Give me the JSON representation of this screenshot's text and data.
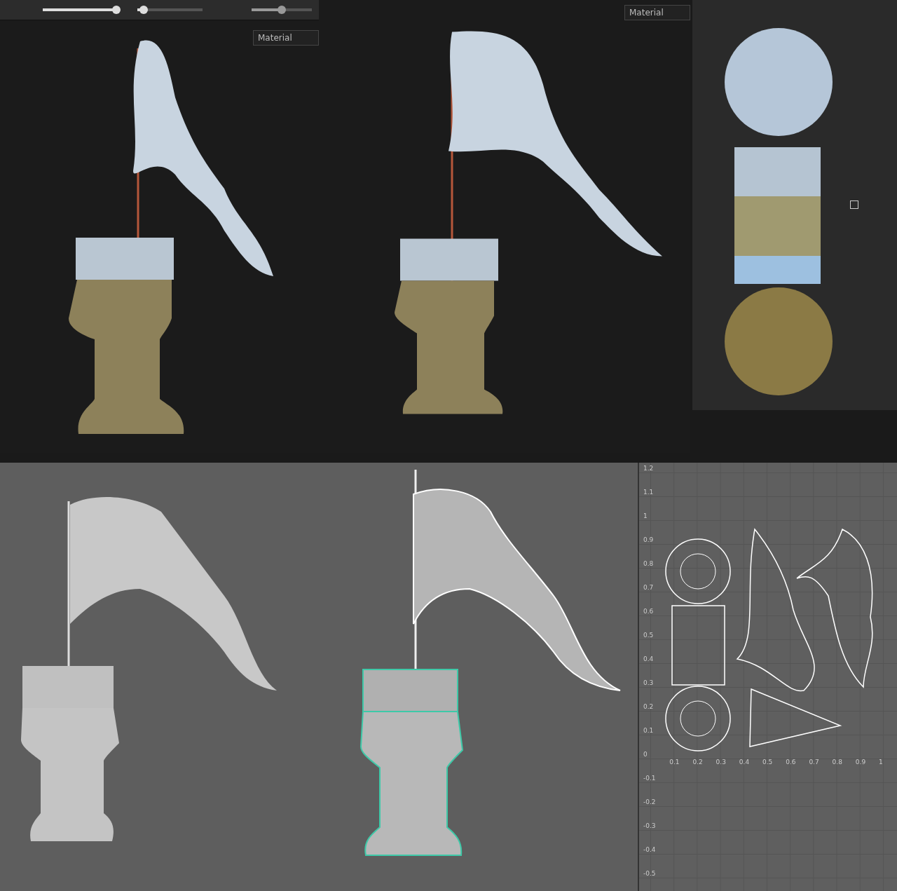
{
  "top_left_viewport": {
    "sliders": [
      {
        "level": 1.0
      },
      {
        "level": 0.1
      },
      {
        "level": 0.5
      }
    ],
    "material_dropdown": "Material"
  },
  "top_middle_viewport": {
    "material_dropdown": "Material"
  },
  "texture_preview": {
    "checkbox": {
      "checked": false
    }
  },
  "uv_editor": {
    "y_ticks": [
      "1.2",
      "1.1",
      "1",
      "0.9",
      "0.8",
      "0.7",
      "0.6",
      "0.5",
      "0.4",
      "0.3",
      "0.2",
      "0.1",
      "0",
      "-0.1",
      "-0.2",
      "-0.3",
      "-0.4",
      "-0.5"
    ],
    "x_ticks": [
      "0.1",
      "0.2",
      "0.3",
      "0.4",
      "0.5",
      "0.6",
      "0.7",
      "0.8",
      "0.9",
      "1"
    ]
  }
}
